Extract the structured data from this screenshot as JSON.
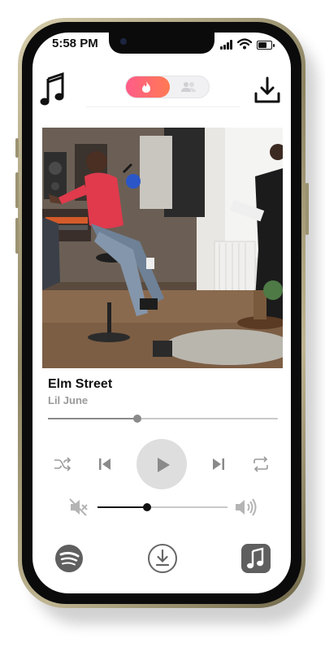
{
  "status": {
    "time": "5:58 PM"
  },
  "header": {
    "left_icon": "music-note-icon",
    "right_icon": "download-icon",
    "toggle": {
      "active": "flame-icon",
      "inactive": "people-icon",
      "accent_from": "#ff5c8a",
      "accent_to": "#ff7a52"
    }
  },
  "track": {
    "title": "Elm Street",
    "artist": "Lil June",
    "progress_fraction": 0.39
  },
  "controls": {
    "shuffle": "shuffle-icon",
    "previous": "skip-back-icon",
    "play": "play-icon",
    "next": "skip-forward-icon",
    "repeat": "repeat-icon"
  },
  "volume": {
    "level_fraction": 0.38,
    "mute_icon": "speaker-muted-icon",
    "max_icon": "speaker-loud-icon"
  },
  "bottom_bar": [
    "spotify-icon",
    "download-circle-icon",
    "apple-music-icon"
  ]
}
